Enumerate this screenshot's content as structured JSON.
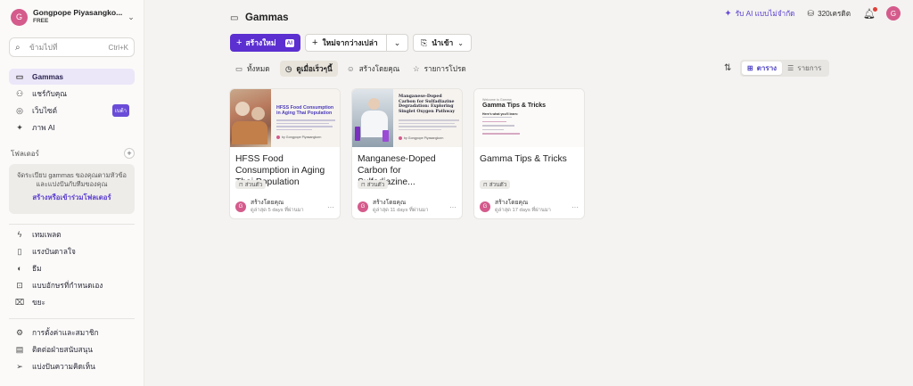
{
  "workspace": {
    "avatar_letter": "G",
    "name": "Gongpope Piyasangko...",
    "plan": "FREE"
  },
  "search": {
    "placeholder": "ข้ามไปที่",
    "shortcut": "Ctrl+K"
  },
  "sidebar_primary": [
    {
      "label": "Gammas",
      "icon": "layers-icon",
      "active": true
    },
    {
      "label": "แชร์กับคุณ",
      "icon": "users-icon"
    },
    {
      "label": "เว็บไซต์",
      "icon": "globe-icon",
      "badge": "เบต้า"
    },
    {
      "label": "ภาพ AI",
      "icon": "sparkle-icon"
    }
  ],
  "folders": {
    "heading": "โฟลเดอร์",
    "description": "จัดระเบียบ gammas ของคุณตามหัวข้อและแบ่งปันกับทีมของคุณ",
    "link": "สร้างหรือเข้าร่วมโฟลเดอร์"
  },
  "sidebar_secondary": [
    {
      "label": "เทมเพลต",
      "icon": "template-icon"
    },
    {
      "label": "แรงบันดาลใจ",
      "icon": "book-icon"
    },
    {
      "label": "ธีม",
      "icon": "palette-icon"
    },
    {
      "label": "แบบอักษรที่กำหนดเอง",
      "icon": "font-icon"
    },
    {
      "label": "ขยะ",
      "icon": "trash-icon"
    }
  ],
  "sidebar_footer": [
    {
      "label": "การตั้งค่าและสมาชิก",
      "icon": "settings-icon"
    },
    {
      "label": "ติดต่อฝ่ายสนับสนุน",
      "icon": "chat-icon"
    },
    {
      "label": "แบ่งปันความคิดเห็น",
      "icon": "send-icon"
    }
  ],
  "header": {
    "title": "Gammas",
    "ai_promo": "รับ AI แบบไม่จำกัด",
    "credits": "320เครดิต",
    "user_avatar_letter": "G",
    "colors": {
      "accent": "#5B2FD0",
      "avatar": "#D45B8C",
      "notification": "#E0413A"
    }
  },
  "actions": {
    "create_new": "สร้างใหม่",
    "create_new_badge": "AI",
    "new_blank": "ใหม่จากว่างเปล่า",
    "import": "นำเข้า"
  },
  "filter_tabs": [
    {
      "label": "ทั้งหมด",
      "icon": "layers-icon"
    },
    {
      "label": "ดูเมื่อเร็วๆนี้",
      "icon": "clock-icon",
      "active": true
    },
    {
      "label": "สร้างโดยคุณ",
      "icon": "user-icon"
    },
    {
      "label": "รายการโปรด",
      "icon": "star-icon"
    }
  ],
  "view_toggle": {
    "grid": "ตาราง",
    "list": "รายการ",
    "selected": "grid"
  },
  "cards": [
    {
      "title": "HFSS Food Consumption in Aging Thai Population",
      "tag": "ส่วนตัว",
      "author_letter": "G",
      "created_by": "สร้างโดยคุณ",
      "viewed": "ดูล่าสุด 5 days ที่ผ่านมา",
      "thumb_title": "HFSS Food Consumption in Aging Thai Population",
      "thumb_author": "by Gongpope Piyasangkorn"
    },
    {
      "title": "Manganese-Doped Carbon for Sulfadiazine...",
      "tag": "ส่วนตัว",
      "author_letter": "G",
      "created_by": "สร้างโดยคุณ",
      "viewed": "ดูล่าสุด 11 days ที่ผ่านมา",
      "thumb_title": "Manganese-Doped Carbon for Sulfadiazine Degradation: Exploring Singlet Oxygen Pathway",
      "thumb_author": "by Gongpope Piyasangkorn"
    },
    {
      "title": "Gamma Tips & Tricks",
      "tag": "ส่วนตัว",
      "author_letter": "G",
      "created_by": "สร้างโดยคุณ",
      "viewed": "ดูล่าสุด 17 days ที่ผ่านมา",
      "thumb_kicker": "Welcome to Gamma",
      "thumb_title": "Gamma Tips & Tricks",
      "thumb_sub": "Here's what you'll learn:"
    }
  ]
}
